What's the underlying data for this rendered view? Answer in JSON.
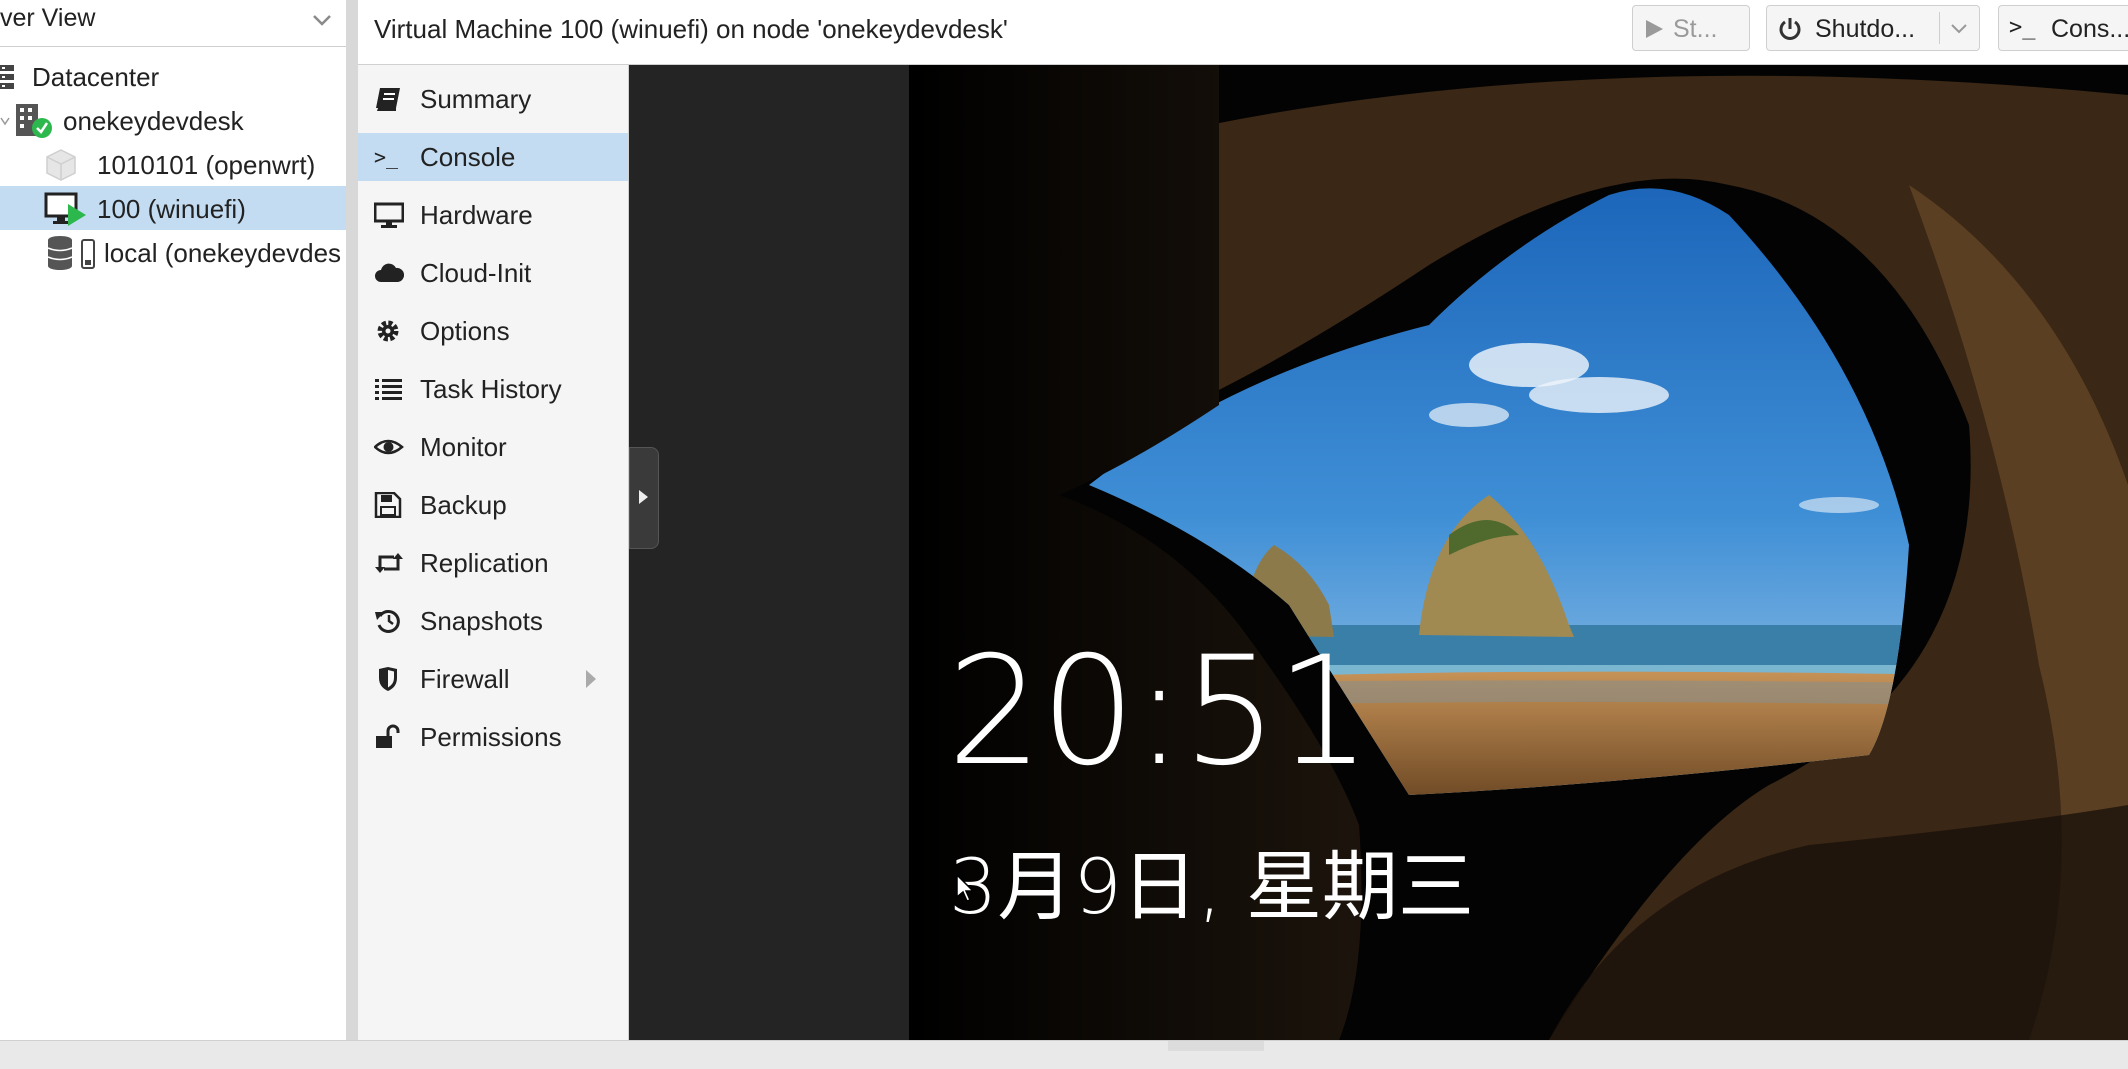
{
  "tree": {
    "view_label": "ver View",
    "items": [
      {
        "label": "Datacenter"
      },
      {
        "label": "onekeydevdesk"
      },
      {
        "label": "1010101 (openwrt)"
      },
      {
        "label": "100 (winuefi)"
      },
      {
        "label": "local (onekeydevdes"
      }
    ]
  },
  "header": {
    "title": "Virtual Machine 100 (winuefi) on node 'onekeydevdesk'",
    "start_label": "St...",
    "shutdown_label": "Shutdo...",
    "console_label": "Cons..."
  },
  "menu": {
    "items": [
      {
        "label": "Summary",
        "icon": "book-icon"
      },
      {
        "label": "Console",
        "icon": "terminal-icon"
      },
      {
        "label": "Hardware",
        "icon": "monitor-icon"
      },
      {
        "label": "Cloud-Init",
        "icon": "cloud-icon"
      },
      {
        "label": "Options",
        "icon": "gear-icon"
      },
      {
        "label": "Task History",
        "icon": "list-icon"
      },
      {
        "label": "Monitor",
        "icon": "eye-icon"
      },
      {
        "label": "Backup",
        "icon": "floppy-icon"
      },
      {
        "label": "Replication",
        "icon": "retweet-icon"
      },
      {
        "label": "Snapshots",
        "icon": "history-icon"
      },
      {
        "label": "Firewall",
        "icon": "shield-icon"
      },
      {
        "label": "Permissions",
        "icon": "unlock-icon"
      }
    ]
  },
  "console_screen": {
    "time": "20:51",
    "date": "3月9日, 星期三"
  },
  "colors": {
    "selected_bg": "#c3dcf2",
    "running_green": "#2db84d"
  }
}
